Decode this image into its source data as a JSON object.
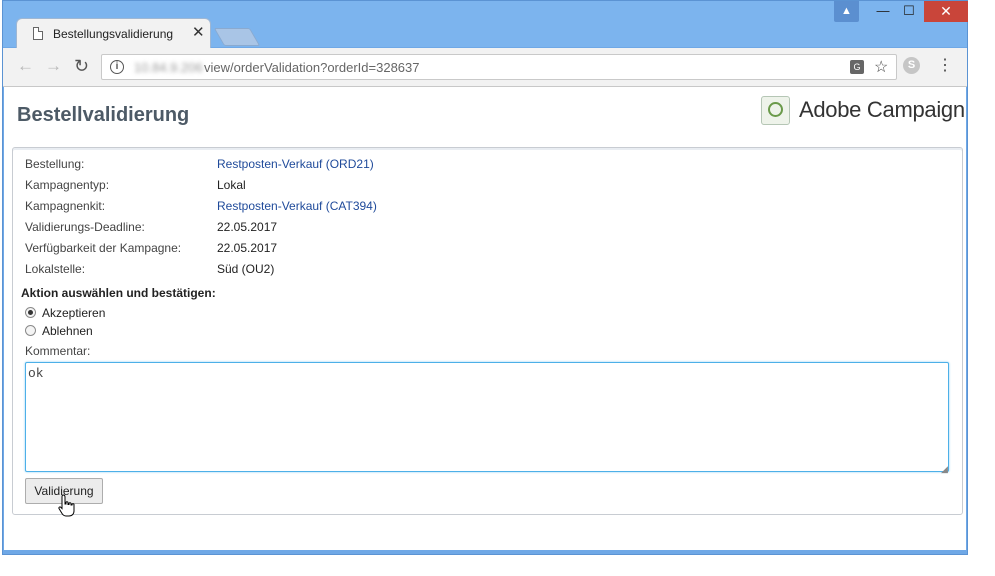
{
  "browser": {
    "tab_title": "Bestellungsvalidierung",
    "tab_close": "✕",
    "url_host": "10.84.9.206",
    "url_path": "view/orderValidation?orderId=328637",
    "window_controls": {
      "minimize": "—",
      "maximize": "☐",
      "close": "✕"
    }
  },
  "page": {
    "title": "Bestellvalidierung",
    "brand_name": "Adobe Campaign"
  },
  "order": {
    "rows": [
      {
        "label": "Bestellung:",
        "value": "Restposten-Verkauf (ORD21)",
        "link": true
      },
      {
        "label": "Kampagnentyp:",
        "value": "Lokal",
        "link": false
      },
      {
        "label": "Kampagnenkit:",
        "value": "Restposten-Verkauf (CAT394)",
        "link": true
      },
      {
        "label": "Validierungs-Deadline:",
        "value": "22.05.2017",
        "link": false
      },
      {
        "label": "Verfügbarkeit der Kampagne:",
        "value": "22.05.2017",
        "link": false
      },
      {
        "label": "Lokalstelle:",
        "value": "Süd (OU2)",
        "link": false
      }
    ]
  },
  "action": {
    "title": "Aktion auswählen und bestätigen:",
    "options": [
      {
        "label": "Akzeptieren",
        "selected": true
      },
      {
        "label": "Ablehnen",
        "selected": false
      }
    ]
  },
  "comment": {
    "label": "Kommentar:",
    "value": "ok"
  },
  "submit": {
    "label": "Validierung"
  },
  "colors": {
    "titlebar": "#7cb4ee",
    "link": "#1f4a9a",
    "close_button": "#c9453a",
    "textarea_focus": "#4db0e8"
  }
}
